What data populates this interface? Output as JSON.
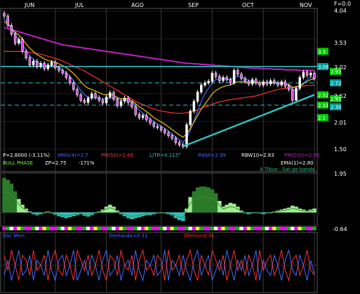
{
  "header": {
    "corner_label": "F=0.0",
    "months": [
      "JUN",
      "JUL",
      "AGO",
      "SEP",
      "OCT",
      "NOV"
    ]
  },
  "price_axis": {
    "ticks": [
      "4.04",
      "3.53",
      "3.02",
      "2.52",
      "2.01",
      "1.50"
    ],
    "right_tags": [
      {
        "label": "3.3",
        "value": 3.3,
        "color": "#00cc00"
      },
      {
        "label": "2.93",
        "value": 2.93,
        "color": "#00cc00"
      },
      {
        "label": "3.06",
        "value": 3.02,
        "color": "#00a0a0"
      },
      {
        "label": "2.72",
        "value": 2.72,
        "color": "#00a0a0"
      },
      {
        "label": "2.52",
        "value": 2.5,
        "color": "#00cc00"
      },
      {
        "label": "2.45",
        "value": 2.43,
        "color": "#00cc00"
      },
      {
        "label": "2.31",
        "value": 2.31,
        "color": "#00cc00"
      },
      {
        "label": "2.30",
        "value": 2.28,
        "color": "#00a0a0"
      },
      {
        "label": "2.1",
        "value": 2.08,
        "color": "#00cc00"
      }
    ]
  },
  "indicator_labels": {
    "row1": [
      {
        "text": "P=2.8000 (-3.11%)",
        "color": "#ffffff"
      },
      {
        "text": "MMA(4)=2.7",
        "color": "#3f6bff"
      },
      {
        "text": "PM(50)=2.68",
        "color": "#ff3030"
      },
      {
        "text": "L/TR=0.115°",
        "color": "#2ec0c0"
      },
      {
        "text": "RWW=2.99",
        "color": "#3f6bff"
      },
      {
        "text": "RBW10=2.83",
        "color": "#ffffff"
      },
      {
        "text": "PM(200)=2.95",
        "color": "#c020c0"
      }
    ],
    "row2": [
      {
        "text": "BULL PHASE",
        "color": "#7cff4a"
      },
      {
        "text": "ZP=2.75",
        "color": "#ffffff"
      },
      {
        "text": "-171%",
        "color": "#ffffff"
      },
      {
        "text": "EMA(1)=2.80",
        "color": "#ffffff"
      }
    ]
  },
  "panel2": {
    "title": "4 Tibus - Sat go bands",
    "top_value": "1.95",
    "bottom_value": "-0.64"
  },
  "panel3": {
    "labels": [
      {
        "text": "Osc Merc",
        "color": "#3f6bff"
      },
      {
        "text": "Demanda=0.31",
        "color": "#3f6bff"
      },
      {
        "text": "Oferta=0.31",
        "color": "#ff3030"
      }
    ]
  },
  "chart_data": [
    {
      "type": "candlestick",
      "title": "",
      "x_labels": [
        "JUN",
        "JUL",
        "AGO",
        "SEP",
        "OCT",
        "NOV"
      ],
      "ylim": [
        1.5,
        4.04
      ],
      "y_ticks": [
        4.04,
        3.53,
        3.02,
        2.52,
        2.01,
        1.5
      ],
      "closes": [
        3.95,
        3.78,
        3.62,
        3.45,
        3.52,
        3.3,
        3.18,
        3.05,
        3.12,
        3.02,
        3.08,
        2.98,
        3.05,
        3.1,
        3.0,
        2.95,
        2.9,
        2.82,
        2.72,
        2.6,
        2.5,
        2.4,
        2.36,
        2.44,
        2.52,
        2.45,
        2.4,
        2.35,
        2.46,
        2.54,
        2.42,
        2.3,
        2.38,
        2.44,
        2.36,
        2.28,
        2.14,
        2.08,
        2.12,
        2.04,
        1.98,
        1.92,
        1.9,
        1.85,
        1.8,
        1.75,
        1.7,
        1.62,
        1.58,
        1.55,
        1.95,
        2.2,
        2.38,
        2.55,
        2.68,
        2.72,
        2.75,
        2.9,
        2.84,
        2.76,
        2.82,
        2.78,
        2.72,
        2.95,
        2.88,
        2.8,
        2.74,
        2.7,
        2.78,
        2.72,
        2.68,
        2.74,
        2.7,
        2.76,
        2.72,
        2.68,
        2.74,
        2.66,
        2.6,
        2.4,
        2.62,
        2.82,
        2.92,
        2.86,
        2.9,
        2.8
      ],
      "series": [
        {
          "name": "PM(200)",
          "color": "#c020c0",
          "values": [
            3.74,
            3.72,
            3.7,
            3.68,
            3.66,
            3.64,
            3.62,
            3.6,
            3.58,
            3.56,
            3.54,
            3.52,
            3.5,
            3.48,
            3.46,
            3.44,
            3.42,
            3.41,
            3.4,
            3.39,
            3.38,
            3.37,
            3.36,
            3.35,
            3.34,
            3.33,
            3.32,
            3.31,
            3.3,
            3.29,
            3.28,
            3.27,
            3.26,
            3.25,
            3.24,
            3.23,
            3.22,
            3.21,
            3.2,
            3.19,
            3.18,
            3.17,
            3.16,
            3.15,
            3.14,
            3.13,
            3.12,
            3.11,
            3.1,
            3.09,
            3.08,
            3.08,
            3.07,
            3.07,
            3.06,
            3.06,
            3.05,
            3.05,
            3.04,
            3.04,
            3.03,
            3.03,
            3.02,
            3.02,
            3.01,
            3.01,
            3.0,
            3.0,
            2.99,
            2.99,
            2.99,
            2.98,
            2.98,
            2.98,
            2.97,
            2.97,
            2.97,
            2.96,
            2.96,
            2.96,
            2.96,
            2.95,
            2.95,
            2.95,
            2.95,
            2.95
          ]
        },
        {
          "name": "PM(50)",
          "color": "#ff3030",
          "values": [
            3.3,
            3.3,
            3.3,
            3.3,
            3.3,
            3.3,
            3.29,
            3.28,
            3.27,
            3.26,
            3.25,
            3.23,
            3.21,
            3.19,
            3.17,
            3.15,
            3.12,
            3.09,
            3.06,
            3.03,
            3.0,
            2.97,
            2.94,
            2.9,
            2.86,
            2.82,
            2.78,
            2.74,
            2.7,
            2.66,
            2.62,
            2.58,
            2.54,
            2.5,
            2.46,
            2.42,
            2.38,
            2.35,
            2.32,
            2.29,
            2.26,
            2.24,
            2.22,
            2.2,
            2.19,
            2.18,
            2.17,
            2.16,
            2.16,
            2.16,
            2.17,
            2.18,
            2.2,
            2.22,
            2.25,
            2.28,
            2.3,
            2.33,
            2.35,
            2.37,
            2.38,
            2.4,
            2.41,
            2.42,
            2.43,
            2.44,
            2.45,
            2.46,
            2.47,
            2.48,
            2.5,
            2.52,
            2.54,
            2.56,
            2.58,
            2.6,
            2.61,
            2.62,
            2.63,
            2.64,
            2.65,
            2.66,
            2.66,
            2.67,
            2.67,
            2.68
          ]
        },
        {
          "name": "MMA(4)",
          "color": "#3f6bff",
          "values": [
            3.9,
            3.82,
            3.72,
            3.6,
            3.52,
            3.42,
            3.32,
            3.22,
            3.15,
            3.1,
            3.07,
            3.05,
            3.04,
            3.04,
            3.04,
            3.0,
            2.95,
            2.9,
            2.84,
            2.76,
            2.67,
            2.58,
            2.5,
            2.45,
            2.44,
            2.45,
            2.44,
            2.42,
            2.42,
            2.45,
            2.44,
            2.42,
            2.4,
            2.4,
            2.39,
            2.36,
            2.3,
            2.22,
            2.16,
            2.1,
            2.06,
            2.0,
            1.96,
            1.92,
            1.88,
            1.83,
            1.78,
            1.72,
            1.67,
            1.63,
            1.7,
            1.84,
            2.02,
            2.2,
            2.38,
            2.52,
            2.62,
            2.72,
            2.78,
            2.8,
            2.8,
            2.79,
            2.78,
            2.82,
            2.84,
            2.83,
            2.8,
            2.76,
            2.76,
            2.74,
            2.72,
            2.72,
            2.72,
            2.73,
            2.73,
            2.72,
            2.72,
            2.7,
            2.67,
            2.58,
            2.57,
            2.62,
            2.7,
            2.78,
            2.83,
            2.8
          ]
        },
        {
          "name": "EMA",
          "color": "#f0c000",
          "values": [
            3.85,
            3.8,
            3.73,
            3.65,
            3.6,
            3.52,
            3.44,
            3.36,
            3.3,
            3.24,
            3.2,
            3.16,
            3.13,
            3.12,
            3.1,
            3.07,
            3.04,
            3.0,
            2.95,
            2.89,
            2.82,
            2.74,
            2.67,
            2.62,
            2.6,
            2.57,
            2.54,
            2.51,
            2.5,
            2.51,
            2.49,
            2.45,
            2.43,
            2.43,
            2.42,
            2.39,
            2.34,
            2.28,
            2.24,
            2.19,
            2.14,
            2.08,
            2.04,
            2.0,
            1.96,
            1.91,
            1.86,
            1.81,
            1.76,
            1.72,
            1.78,
            1.88,
            2.0,
            2.12,
            2.24,
            2.33,
            2.42,
            2.52,
            2.58,
            2.62,
            2.65,
            2.67,
            2.68,
            2.72,
            2.74,
            2.74,
            2.74,
            2.73,
            2.74,
            2.73,
            2.72,
            2.72,
            2.72,
            2.72,
            2.72,
            2.71,
            2.72,
            2.71,
            2.69,
            2.64,
            2.64,
            2.67,
            2.71,
            2.75,
            2.78,
            2.79
          ]
        }
      ],
      "horizontal_levels": [
        {
          "value": 3.02,
          "color": "#2ec0c0",
          "style": "solid"
        },
        {
          "value": 2.72,
          "color": "#2ec0c0",
          "style": "dashed"
        },
        {
          "value": 2.31,
          "color": "#2ec0c0",
          "style": "dashed"
        }
      ],
      "trendline": {
        "from": [
          49,
          1.55
        ],
        "to": [
          85,
          2.5
        ],
        "color": "#2ec0c0"
      }
    },
    {
      "type": "area",
      "title": "4 Tibus - Sat go bands",
      "ylim": [
        -0.64,
        1.95
      ],
      "values": [
        1.8,
        1.7,
        1.5,
        1.1,
        0.7,
        0.4,
        0.2,
        0.05,
        -0.1,
        -0.15,
        -0.1,
        0.0,
        0.05,
        -0.05,
        -0.12,
        -0.2,
        -0.25,
        -0.3,
        -0.25,
        -0.2,
        -0.15,
        -0.1,
        -0.18,
        -0.22,
        -0.15,
        -0.05,
        0.05,
        0.15,
        0.3,
        0.4,
        0.3,
        0.1,
        -0.1,
        -0.2,
        -0.3,
        -0.35,
        -0.3,
        -0.25,
        -0.2,
        -0.15,
        -0.15,
        -0.1,
        -0.05,
        0.0,
        -0.05,
        -0.1,
        -0.15,
        -0.3,
        -0.4,
        -0.45,
        0.2,
        0.8,
        1.1,
        1.3,
        1.35,
        1.35,
        1.3,
        1.2,
        1.0,
        0.6,
        0.3,
        0.4,
        0.5,
        0.45,
        0.3,
        0.1,
        -0.05,
        -0.1,
        -0.05,
        0.0,
        -0.05,
        -0.1,
        -0.05,
        0.0,
        0.05,
        0.1,
        0.15,
        0.2,
        0.25,
        0.35,
        0.3,
        0.2,
        0.15,
        0.1,
        0.15,
        0.2
      ]
    },
    {
      "type": "line",
      "title": "Osc Merc",
      "ylim": [
        0,
        1
      ],
      "series": [
        {
          "name": "Demanda",
          "color": "#3f6bff",
          "values": [
            0.3,
            0.6,
            0.2,
            0.5,
            0.8,
            0.3,
            0.4,
            0.7,
            0.2,
            0.6,
            0.5,
            0.3,
            0.8,
            0.4,
            0.2,
            0.6,
            0.7,
            0.3,
            0.5,
            0.8,
            0.2,
            0.4,
            0.6,
            0.3,
            0.7,
            0.5,
            0.2,
            0.6,
            0.8,
            0.3,
            0.4,
            0.7,
            0.2,
            0.5,
            0.6,
            0.3,
            0.8,
            0.4,
            0.2,
            0.6,
            0.5,
            0.7,
            0.3,
            0.4,
            0.8,
            0.2,
            0.6,
            0.5,
            0.3,
            0.7,
            0.4,
            0.2,
            0.6,
            0.8,
            0.3,
            0.5,
            0.7,
            0.2,
            0.4,
            0.6,
            0.3,
            0.8,
            0.5,
            0.2,
            0.6,
            0.4,
            0.7,
            0.3,
            0.5,
            0.8,
            0.2,
            0.6,
            0.4,
            0.3,
            0.7,
            0.5,
            0.2,
            0.6,
            0.8,
            0.4,
            0.3,
            0.7,
            0.5,
            0.2,
            0.6,
            0.31
          ]
        },
        {
          "name": "Oferta",
          "color": "#ff3030",
          "values": [
            0.7,
            0.4,
            0.8,
            0.5,
            0.2,
            0.7,
            0.6,
            0.3,
            0.8,
            0.4,
            0.5,
            0.7,
            0.2,
            0.6,
            0.8,
            0.4,
            0.3,
            0.7,
            0.5,
            0.2,
            0.8,
            0.6,
            0.4,
            0.7,
            0.3,
            0.5,
            0.8,
            0.4,
            0.2,
            0.7,
            0.6,
            0.3,
            0.8,
            0.5,
            0.4,
            0.7,
            0.2,
            0.6,
            0.8,
            0.4,
            0.5,
            0.3,
            0.7,
            0.6,
            0.2,
            0.8,
            0.4,
            0.5,
            0.7,
            0.3,
            0.6,
            0.8,
            0.4,
            0.2,
            0.7,
            0.5,
            0.3,
            0.8,
            0.6,
            0.4,
            0.7,
            0.2,
            0.5,
            0.8,
            0.4,
            0.6,
            0.3,
            0.7,
            0.5,
            0.2,
            0.8,
            0.4,
            0.6,
            0.7,
            0.3,
            0.5,
            0.8,
            0.4,
            0.2,
            0.6,
            0.7,
            0.3,
            0.5,
            0.8,
            0.4,
            0.31
          ]
        }
      ]
    }
  ]
}
